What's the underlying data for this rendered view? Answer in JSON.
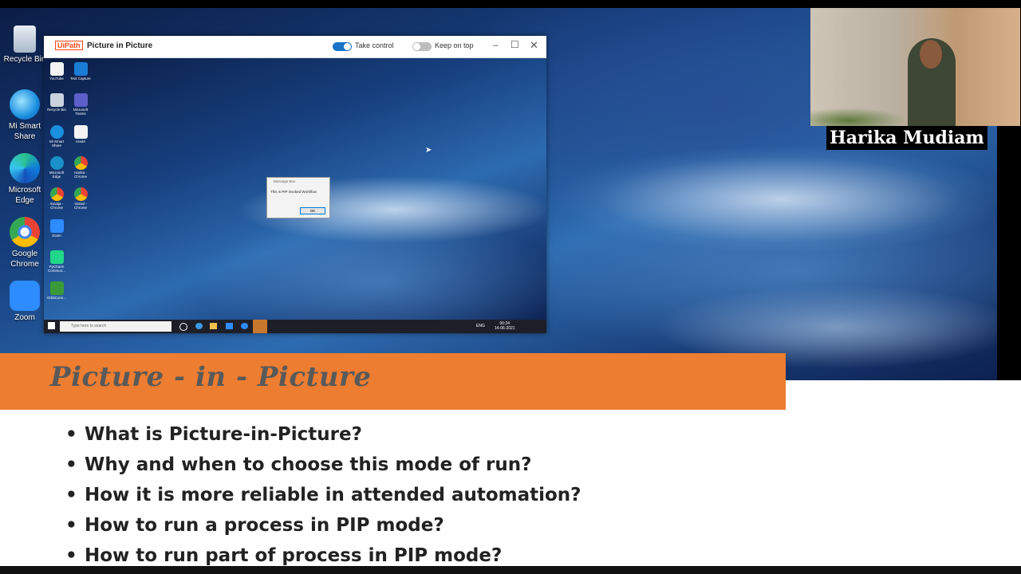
{
  "pip_window": {
    "app_logo": "UiPath",
    "title": "Picture in Picture",
    "take_control_label": "Take control",
    "take_control_on": true,
    "keep_on_top_label": "Keep on top",
    "keep_on_top_on": false
  },
  "desktop_icons": [
    {
      "label": "Recycle Bin",
      "icon": "recycle-bin-icon"
    },
    {
      "label": "Mi Smart Share",
      "icon": "share-icon"
    },
    {
      "label": "Microsoft Edge",
      "icon": "edge-icon"
    },
    {
      "label": "Google Chrome",
      "icon": "chrome-icon"
    },
    {
      "label": "Zoom",
      "icon": "zoom-icon"
    }
  ],
  "mini_desktop_icons": [
    {
      "label": "YouTube"
    },
    {
      "label": "Text Capture"
    },
    {
      "label": "Recycle Bin"
    },
    {
      "label": "Microsoft Teams"
    },
    {
      "label": "Mi Smart Share"
    },
    {
      "label": "sssd4"
    },
    {
      "label": "Microsoft Edge"
    },
    {
      "label": "Harika - Chrome"
    },
    {
      "label": "Suvaja - Chrome"
    },
    {
      "label": "Varsal - Chrome"
    },
    {
      "label": "Zoom"
    },
    {
      "label": "PyCharm Commun..."
    },
    {
      "label": "OrbitConn..."
    }
  ],
  "message_box": {
    "title": "Message Box",
    "message": "This is PIP invoked Workflow",
    "ok_label": "OK"
  },
  "mini_taskbar": {
    "search_placeholder": "Type here to search",
    "time": "00:24",
    "date": "14-06-2021",
    "lang": "ENG"
  },
  "presenter": {
    "name": "Harika Mudiam"
  },
  "slide": {
    "title": "Picture - in - Picture",
    "bullets": [
      "What is Picture-in-Picture?",
      "Why and when to choose this mode of run?",
      "How it is more reliable in attended automation?",
      "How to run a process in PIP mode?",
      "How to run part of process in PIP mode?"
    ]
  },
  "colors": {
    "accent_orange": "#ed7d31",
    "title_gray": "#595959",
    "toggle_blue": "#1a73c8"
  }
}
